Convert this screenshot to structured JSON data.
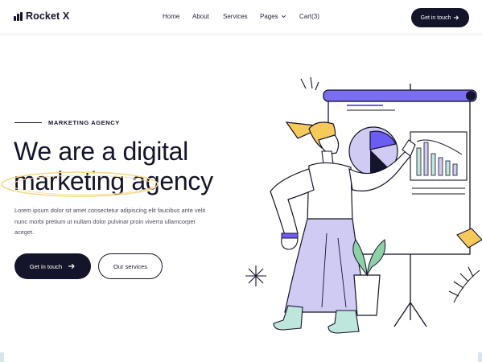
{
  "brand": {
    "name": "Rocket X"
  },
  "nav": {
    "items": [
      {
        "label": "Home"
      },
      {
        "label": "About"
      },
      {
        "label": "Services"
      },
      {
        "label": "Pages"
      },
      {
        "label": "Cart(3)"
      }
    ],
    "cta_label": "Get in touch"
  },
  "hero": {
    "eyebrow": "MARKETING AGENCY",
    "headline_line1": "We are a digital",
    "headline_line2": "marketing agency",
    "description": "Lorem ipsum dolor sit amet consectetur adipiscing elit faucibus ante velit nunc morbi pretium ut nullam dolor pulvinar proin viverra ullamcorper aceget.",
    "primary_button": "Get in touch",
    "secondary_button": "Our services"
  },
  "icons": {
    "logo": "bar-chart-logo-icon",
    "pages_dropdown": "chevron-down-icon",
    "cta_arrow": "arrow-right-icon",
    "primary_arrow": "arrow-right-icon"
  },
  "colors": {
    "primary": "#14142b",
    "accent_purple": "#6b5cf5",
    "lavender": "#cfcbf2",
    "yellow": "#f6c95b",
    "mint": "#bfe6dd",
    "green": "#8ed1a6",
    "background": "#ffffff"
  }
}
